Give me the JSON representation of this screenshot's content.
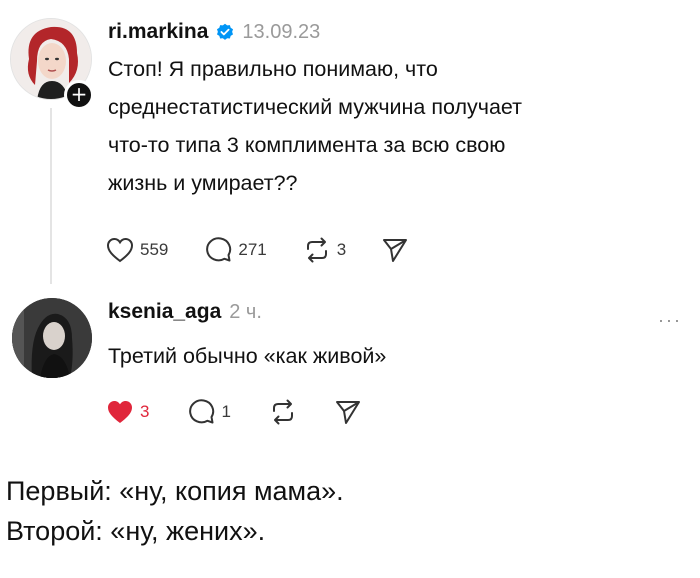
{
  "post": {
    "username": "ri.markina",
    "date": "13.09.23",
    "lines": [
      "Стоп! Я правильно понимаю, что",
      "среднестатистический мужчина получает",
      "что-то типа 3 комплимента за всю свою",
      "жизнь и умирает??"
    ],
    "likes": "559",
    "comments": "271",
    "reposts": "3",
    "avatar_icon": "profile-photo-red-hair",
    "follow_icon": "plus-icon"
  },
  "reply": {
    "username": "ksenia_aga",
    "time": "2 ч.",
    "text": "Третий обычно «как живой»",
    "likes": "3",
    "comments": "1",
    "like_color": "#e0263b",
    "more": "···"
  },
  "caption": {
    "line1": "Первый: «ну, копия мама».",
    "line2": "Второй: «ну, жених»."
  },
  "colors": {
    "verified": "#0095f6",
    "muted": "#9a9a9a"
  }
}
